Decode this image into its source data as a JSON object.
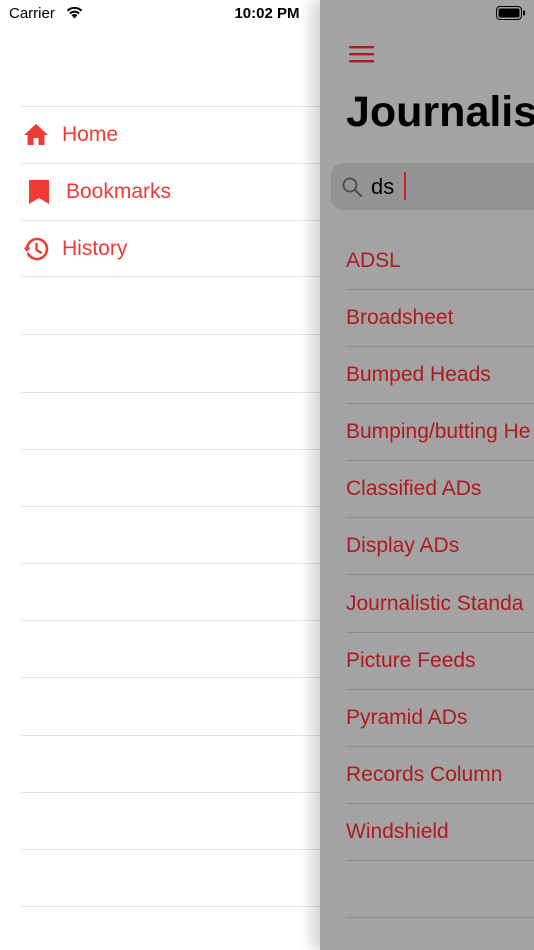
{
  "status_bar": {
    "carrier": "Carrier",
    "time": "10:02 PM"
  },
  "side_menu": {
    "items": [
      {
        "label": "Home",
        "icon": "home-icon"
      },
      {
        "label": "Bookmarks",
        "icon": "bookmark-icon"
      },
      {
        "label": "History",
        "icon": "history-icon"
      }
    ]
  },
  "main": {
    "title": "Journalis",
    "search": {
      "value": "ds"
    },
    "results": [
      "ADSL",
      "Broadsheet",
      "Bumped Heads",
      "Bumping/butting He",
      "Classified ADs",
      "Display ADs",
      "Journalistic Standa",
      "Picture Feeds",
      "Pyramid ADs",
      "Records Column",
      "Windshield"
    ]
  },
  "colors": {
    "accent": "#ef3b36",
    "accent_dimmed": "#b0191f",
    "overlay": "#a3a3a3"
  }
}
